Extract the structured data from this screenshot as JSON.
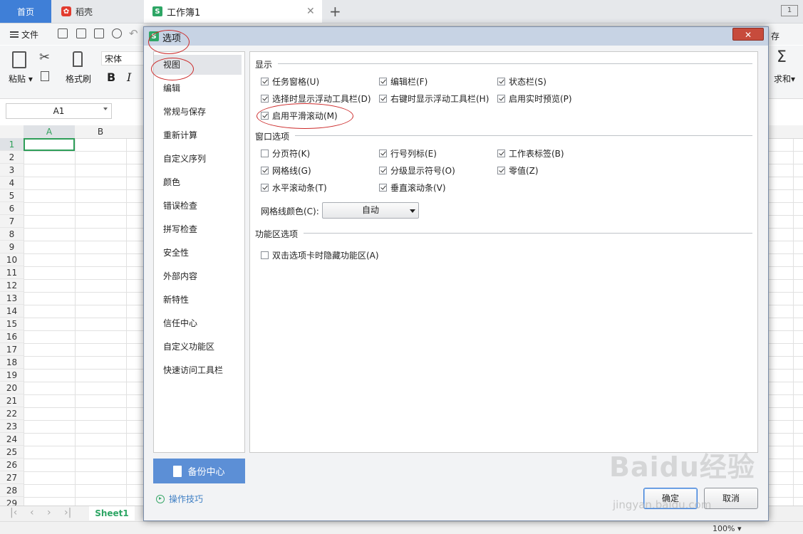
{
  "tabs": {
    "home": "首页",
    "daoke": "稻壳",
    "workbook": "工作簿1",
    "window_count": "1"
  },
  "menubar": {
    "file_label": "文件",
    "right_partial": "存"
  },
  "toolbar": {
    "paste_label": "粘贴",
    "format_painter_label": "格式刷",
    "font_name": "宋体",
    "bold_label": "B",
    "italic_label": "I",
    "sum_label": "求和"
  },
  "formula_bar": {
    "name_box": "A1"
  },
  "sheet": {
    "columns": [
      "A",
      "B"
    ],
    "rows": [
      "1",
      "2",
      "3",
      "4",
      "5",
      "6",
      "7",
      "8",
      "9",
      "10",
      "11",
      "12",
      "13",
      "14",
      "15",
      "16",
      "17",
      "18",
      "19",
      "20",
      "21",
      "22",
      "23",
      "24",
      "25",
      "26",
      "27",
      "28",
      "29"
    ],
    "selected_cell": "A1",
    "sheet_tab": "Sheet1",
    "zoom": "100%"
  },
  "dialog": {
    "title": "选项",
    "close_label": "✕",
    "nav": [
      "视图",
      "编辑",
      "常规与保存",
      "重新计算",
      "自定义序列",
      "颜色",
      "错误检查",
      "拼写检查",
      "安全性",
      "外部内容",
      "新特性",
      "信任中心",
      "自定义功能区",
      "快速访问工具栏"
    ],
    "active_nav": "视图",
    "sections": {
      "display": {
        "title": "显示",
        "options": [
          {
            "label": "任务窗格(U)",
            "checked": true
          },
          {
            "label": "编辑栏(F)",
            "checked": true
          },
          {
            "label": "状态栏(S)",
            "checked": true
          },
          {
            "label": "选择时显示浮动工具栏(D)",
            "checked": true
          },
          {
            "label": "右键时显示浮动工具栏(H)",
            "checked": true
          },
          {
            "label": "启用实时预览(P)",
            "checked": true
          },
          {
            "label": "启用平滑滚动(M)",
            "checked": true
          }
        ]
      },
      "window": {
        "title": "窗口选项",
        "options": [
          {
            "label": "分页符(K)",
            "checked": false
          },
          {
            "label": "行号列标(E)",
            "checked": true
          },
          {
            "label": "工作表标签(B)",
            "checked": true
          },
          {
            "label": "网格线(G)",
            "checked": true
          },
          {
            "label": "分级显示符号(O)",
            "checked": true
          },
          {
            "label": "零值(Z)",
            "checked": true
          },
          {
            "label": "水平滚动条(T)",
            "checked": true
          },
          {
            "label": "垂直滚动条(V)",
            "checked": true
          }
        ],
        "grid_color_label": "网格线颜色(C):",
        "grid_color_value": "自动"
      },
      "ribbon": {
        "title": "功能区选项",
        "options": [
          {
            "label": "双击选项卡时隐藏功能区(A)",
            "checked": false
          }
        ]
      }
    },
    "backup_label": "备份中心",
    "tips_label": "操作技巧",
    "ok_label": "确定",
    "cancel_label": "取消"
  },
  "watermark": {
    "text": "Baidu经验",
    "url": "jingyan.baidu.com"
  },
  "colors": {
    "accent": "#2ea665",
    "home_tab": "#3f7fd7",
    "annotation": "#cc2a2a",
    "backup": "#5c8fd6"
  }
}
